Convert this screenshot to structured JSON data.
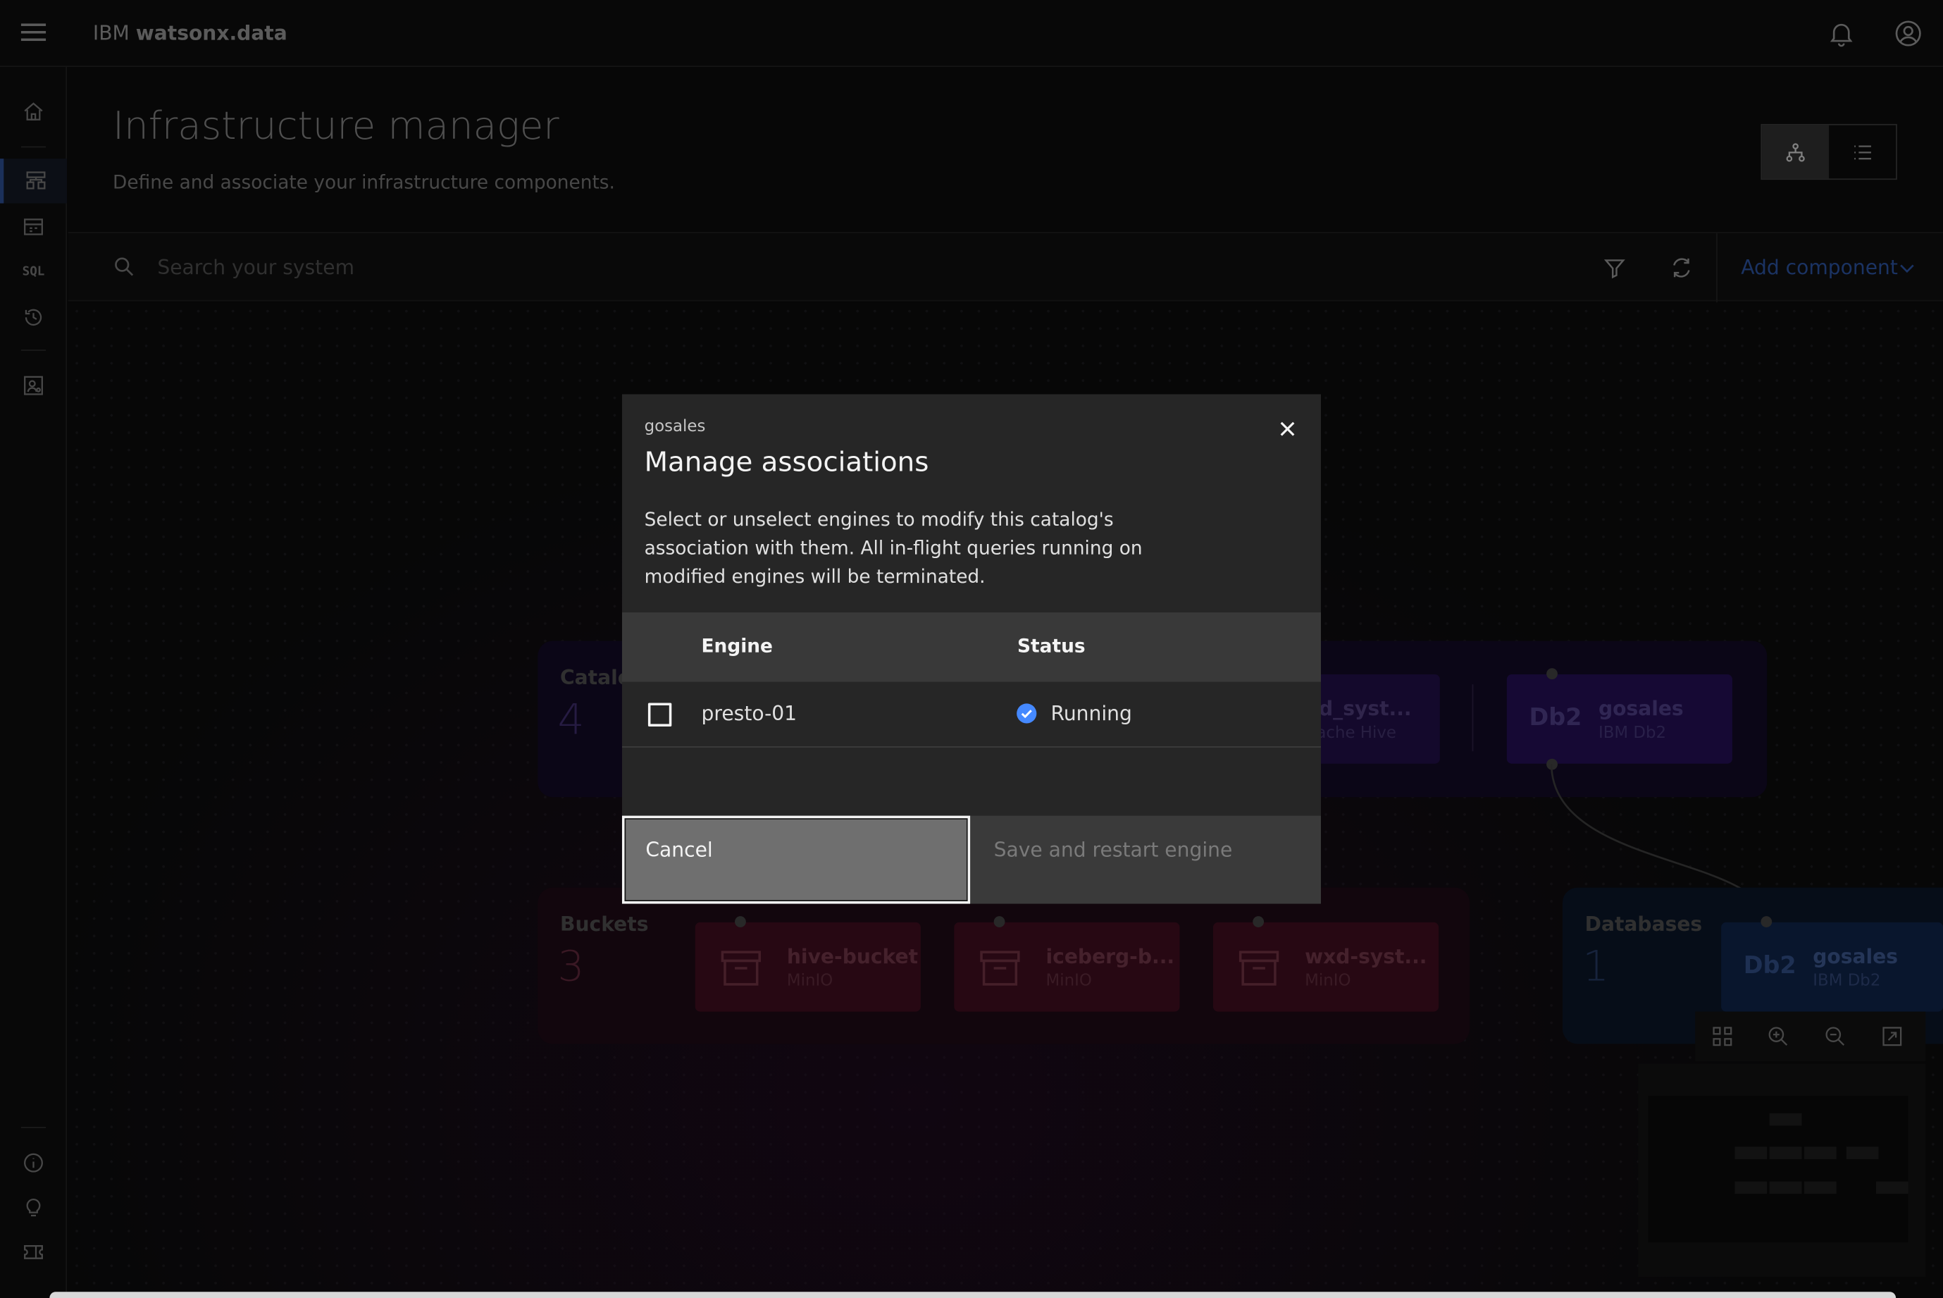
{
  "header": {
    "brand_prefix": "IBM",
    "brand_name": "watsonx.data"
  },
  "sidebar": {
    "items": [
      {
        "icon": "home-icon"
      },
      {
        "icon": "infrastructure-icon",
        "active": true
      },
      {
        "icon": "data-manager-icon"
      },
      {
        "label": "SQL"
      },
      {
        "icon": "history-icon"
      },
      {
        "icon": "access-control-icon"
      },
      {
        "icon": "info-icon"
      },
      {
        "icon": "lightbulb-icon"
      },
      {
        "icon": "ticket-icon"
      }
    ]
  },
  "page": {
    "title": "Infrastructure manager",
    "description": "Define and associate your infrastructure components."
  },
  "toolbar": {
    "search_placeholder": "Search your system",
    "add_component_label": "Add component"
  },
  "canvas": {
    "catalogs": {
      "label": "Catalo",
      "count": "4"
    },
    "buckets": {
      "label": "Buckets",
      "count": "3"
    },
    "databases": {
      "label": "Databases",
      "count": "1"
    },
    "catalog_nodes": [
      {
        "title": "xd_syst...",
        "subtitle": "pache Hive"
      },
      {
        "badge": "Db2",
        "title": "gosales",
        "subtitle": "IBM Db2"
      }
    ],
    "bucket_nodes": [
      {
        "title": "hive-bucket",
        "subtitle": "MinIO"
      },
      {
        "title": "iceberg-b...",
        "subtitle": "MinIO"
      },
      {
        "title": "wxd-syst...",
        "subtitle": "MinIO"
      }
    ],
    "database_nodes": [
      {
        "badge": "Db2",
        "title": "gosales",
        "subtitle": "IBM Db2"
      }
    ]
  },
  "modal": {
    "subtitle": "gosales",
    "title": "Manage associations",
    "description": "Select or unselect engines to modify this catalog's association with them. All in-flight queries running on modified engines will be terminated.",
    "table": {
      "headers": {
        "engine": "Engine",
        "status": "Status"
      },
      "rows": [
        {
          "engine": "presto-01",
          "status": "Running",
          "checked": false
        }
      ]
    },
    "cancel_label": "Cancel",
    "save_label": "Save and restart engine"
  },
  "colors": {
    "accent_blue": "#4589ff",
    "catalog_purple": "#2a1159",
    "bucket_red": "#3d0d1e",
    "database_blue": "#0b1a36"
  }
}
